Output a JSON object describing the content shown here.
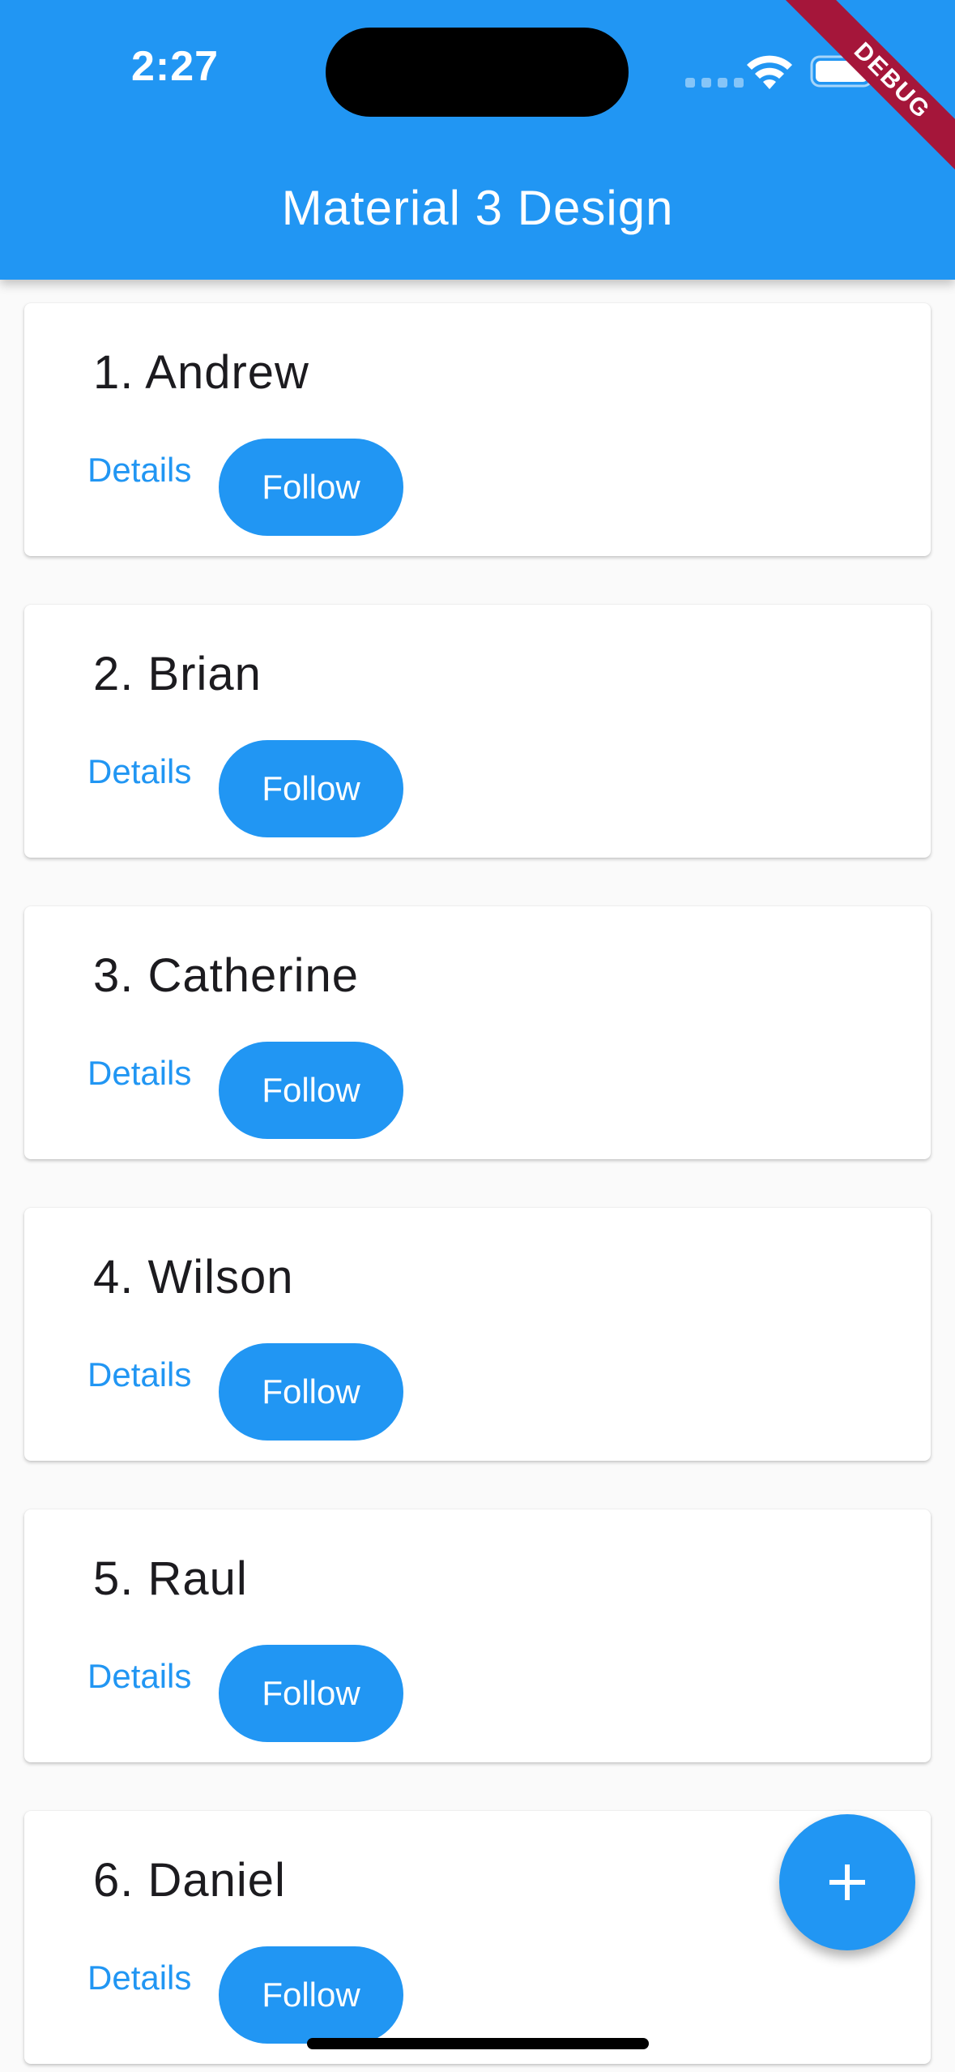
{
  "status_bar": {
    "time": "2:27"
  },
  "app_bar": {
    "title": "Material 3 Design",
    "color": "#2196f3"
  },
  "debug_banner": "DEBUG",
  "list": {
    "items": [
      {
        "title": "1. Andrew",
        "details_label": "Details",
        "follow_label": "Follow"
      },
      {
        "title": "2. Brian",
        "details_label": "Details",
        "follow_label": "Follow"
      },
      {
        "title": "3. Catherine",
        "details_label": "Details",
        "follow_label": "Follow"
      },
      {
        "title": "4. Wilson",
        "details_label": "Details",
        "follow_label": "Follow"
      },
      {
        "title": "5. Raul",
        "details_label": "Details",
        "follow_label": "Follow"
      },
      {
        "title": "6. Daniel",
        "details_label": "Details",
        "follow_label": "Follow"
      }
    ]
  },
  "fab": {
    "icon": "plus-icon"
  },
  "colors": {
    "primary": "#2196f3",
    "background": "#fafafa",
    "card": "#ffffff",
    "debug": "#a5163a"
  }
}
